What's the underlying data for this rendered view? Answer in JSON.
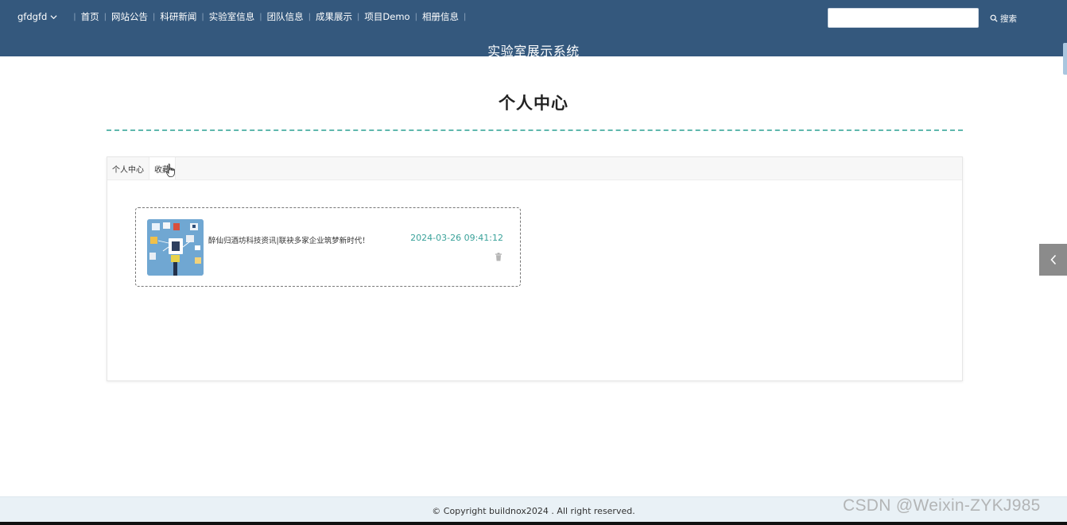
{
  "header": {
    "username": "gfdgfd",
    "nav_items": [
      "首页",
      "网站公告",
      "科研新闻",
      "实验室信息",
      "团队信息",
      "成果展示",
      "项目Demo",
      "相册信息"
    ],
    "search": {
      "value": "",
      "button_label": "搜索"
    },
    "site_title": "实验室展示系统"
  },
  "main": {
    "heading": "个人中心",
    "tabs": [
      {
        "label": "个人中心",
        "active": false
      },
      {
        "label": "收藏",
        "active": true
      }
    ],
    "favorites": [
      {
        "title": "醉仙归酒坊科技资讯|联袂多家企业筑梦新时代！",
        "time": "2024-03-26 09:41:12"
      }
    ]
  },
  "footer": {
    "copyright": "© Copyright buildnox2024 . All right reserved.",
    "watermark": "CSDN @Weixin-ZYKJ985"
  },
  "colors": {
    "header_bg": "#34587d",
    "accent_teal": "#3aa29a",
    "divider": "#5fb8ad",
    "footer_bg": "#e9f1f6",
    "side_toggle_bg": "#8b8b8b"
  },
  "icons": [
    "chevron-down-icon",
    "search-icon",
    "trash-icon",
    "chevron-left-icon",
    "pointer-cursor-icon"
  ]
}
